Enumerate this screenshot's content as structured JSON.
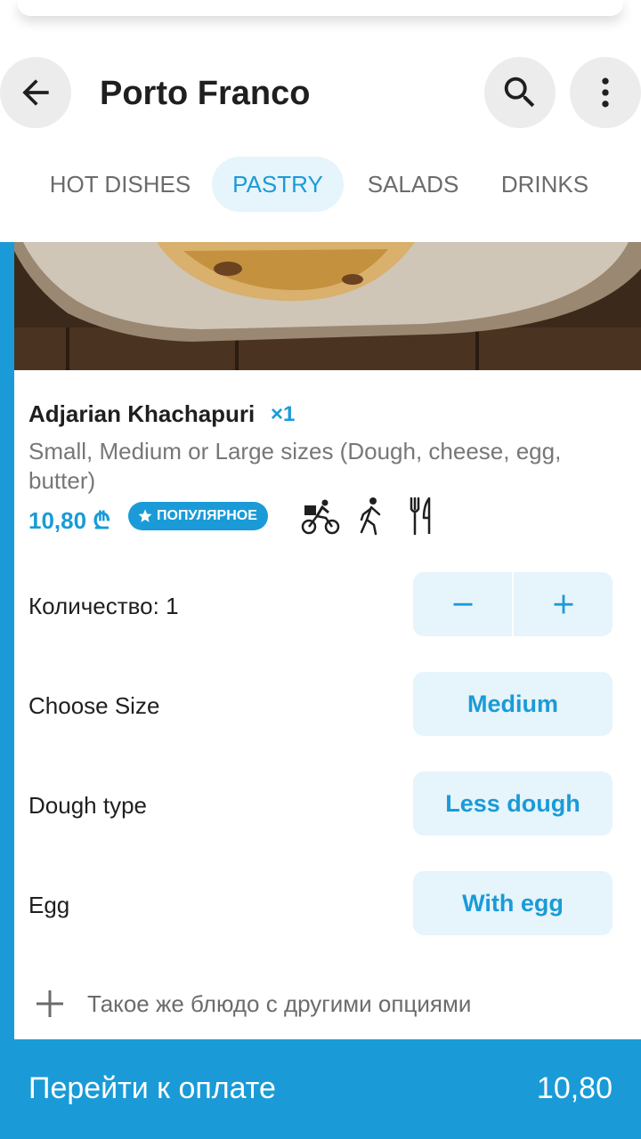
{
  "header": {
    "title": "Porto Franco",
    "back_icon": "arrow-left-icon",
    "search_icon": "search-icon",
    "menu_icon": "more-vertical-icon"
  },
  "tabs": [
    {
      "label": "HOT DISHES",
      "active": false
    },
    {
      "label": "PASTRY",
      "active": true
    },
    {
      "label": "SALADS",
      "active": false
    },
    {
      "label": "DRINKS",
      "active": false
    }
  ],
  "dish": {
    "name": "Adjarian Khachapuri",
    "count": "×1",
    "description": "Small, Medium or Large sizes (Dough, cheese, egg, butter)",
    "price": "10,80 ₾",
    "badge": "ПОПУЛЯРНОЕ",
    "service_icons": [
      "delivery-bike-icon",
      "takeaway-walk-icon",
      "dine-in-cutlery-icon"
    ]
  },
  "options": {
    "quantity_label": "Количество: 1",
    "size_label": "Choose Size",
    "size_value": "Medium",
    "dough_label": "Dough type",
    "dough_value": "Less dough",
    "egg_label": "Egg",
    "egg_value": "With egg"
  },
  "add_same": "Такое же блюдо с другими опциями",
  "checkout": {
    "label": "Перейти к оплате",
    "total": "10,80"
  },
  "colors": {
    "accent": "#1a9bd7",
    "accent_light": "#e6f4fb",
    "circle_button": "#ececec"
  }
}
